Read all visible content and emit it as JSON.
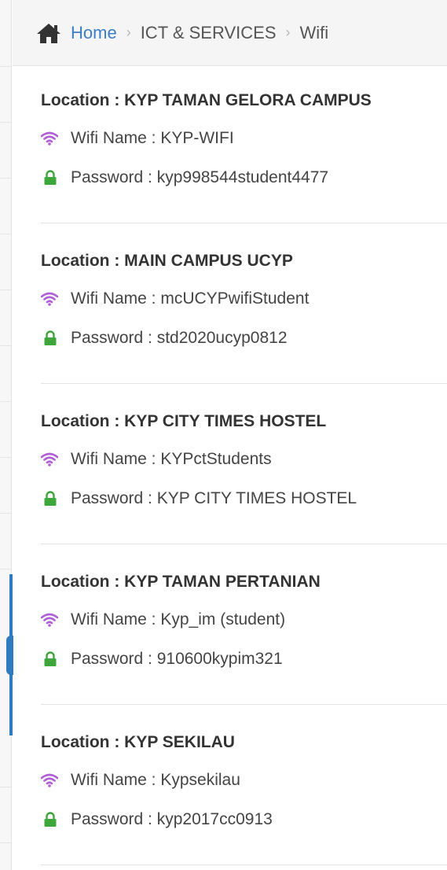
{
  "breadcrumb": {
    "home": "Home",
    "separator": "›",
    "section": "ICT & SERVICES",
    "page": "Wifi"
  },
  "colors": {
    "link": "#3b7ec6",
    "wifi_icon": "#b05fd6",
    "lock_icon": "#3ea63a",
    "accent": "#2f7bbf"
  },
  "icons": {
    "home": "home-icon",
    "wifi": "wifi-icon",
    "lock": "lock-icon"
  },
  "wifi_list": [
    {
      "location": "Location : KYP TAMAN GELORA CAMPUS",
      "wifi": "Wifi Name : KYP-WIFI",
      "password": "Password : kyp998544student4477"
    },
    {
      "location": "Location : MAIN CAMPUS UCYP",
      "wifi": "Wifi Name : mcUCYPwifiStudent",
      "password": "Password : std2020ucyp0812"
    },
    {
      "location": "Location : KYP CITY TIMES HOSTEL",
      "wifi": "Wifi Name : KYPctStudents",
      "password": "Password : KYP CITY TIMES HOSTEL"
    },
    {
      "location": "Location : KYP TAMAN PERTANIAN",
      "wifi": "Wifi Name : Kyp_im (student)",
      "password": "Password : 910600kypim321"
    },
    {
      "location": "Location : KYP SEKILAU",
      "wifi": "Wifi Name : Kypsekilau",
      "password": "Password : kyp2017cc0913"
    }
  ]
}
